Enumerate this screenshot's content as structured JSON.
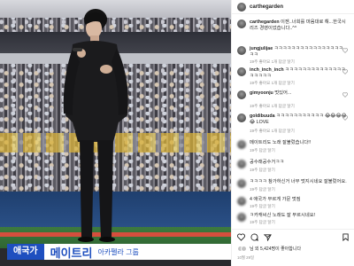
{
  "post": {
    "username": "carthegarden"
  },
  "photo": {
    "caption_tag": "애국가",
    "caption_name": "메이트리",
    "caption_sub": "아카펠라 그룹"
  },
  "comments": [
    {
      "username": "carthegarden",
      "text": "이젠..너희를 마음대로 해...한국시리즈 경영이었습니다..^^",
      "meta": ""
    },
    {
      "username": "jungjulijae",
      "text": "ㅋㅋㅋㅋㅋㅋㅋㅋㅋㅋㅋㅋㅋㅋㅋㅋㅋㅋ",
      "meta": "19주  좋아요 1개  답글 달기"
    },
    {
      "username": "inch_inch_inch",
      "text": "ㅋㅋㅋㅋㅋㅋㅋㅋㅋㅋㅋㅋㅋㅋㅋㅋㅋㅋㅋ",
      "meta": "19주  좋아요 1개  답글 달기"
    },
    {
      "username": "gimyoonju",
      "text": "멋있어...",
      "meta": "19주  좋아요 1개  답글 달기"
    },
    {
      "username": "goldibuuda",
      "text": "ㅋㅋㅋㅋㅋㅋㅋㅋㅋㅋㅋ 😂😂😂😂😂 LOVE",
      "meta": "19주  좋아요 1개  답글 달기"
    },
    {
      "username": "",
      "text": "메이트리도 노래 잘불렀습니다!!",
      "meta": "19주  답글 달기"
    },
    {
      "username": "",
      "text": "공수래공수거ㅋㅋ",
      "meta": "19주  답글 달기"
    },
    {
      "username": "",
      "text": "ㅋㅋㅋㅋ 참가하신거 너무 멋지시네요 잘불렀어요.",
      "meta": "19주  답글 달기"
    },
    {
      "username": "",
      "text": "4 애국가 부르게 가문 멋짐",
      "meta": "19주  답글 달기"
    },
    {
      "username": "",
      "text": "ㅋ카캐씨신 노래도 잘 부르시네요!",
      "meta": "19주  답글 달기"
    }
  ],
  "footer": {
    "likes_prefix": "님 외 5,424명이 좋아합니다",
    "date": "10월 29일"
  },
  "icons": {
    "heart": "heart-icon",
    "comment": "comment-icon",
    "share": "share-icon",
    "bookmark": "bookmark-icon"
  },
  "colors": {
    "caption_blue": "#1e4fbf",
    "meta_gray": "#8e8e8e",
    "text": "#262626"
  }
}
